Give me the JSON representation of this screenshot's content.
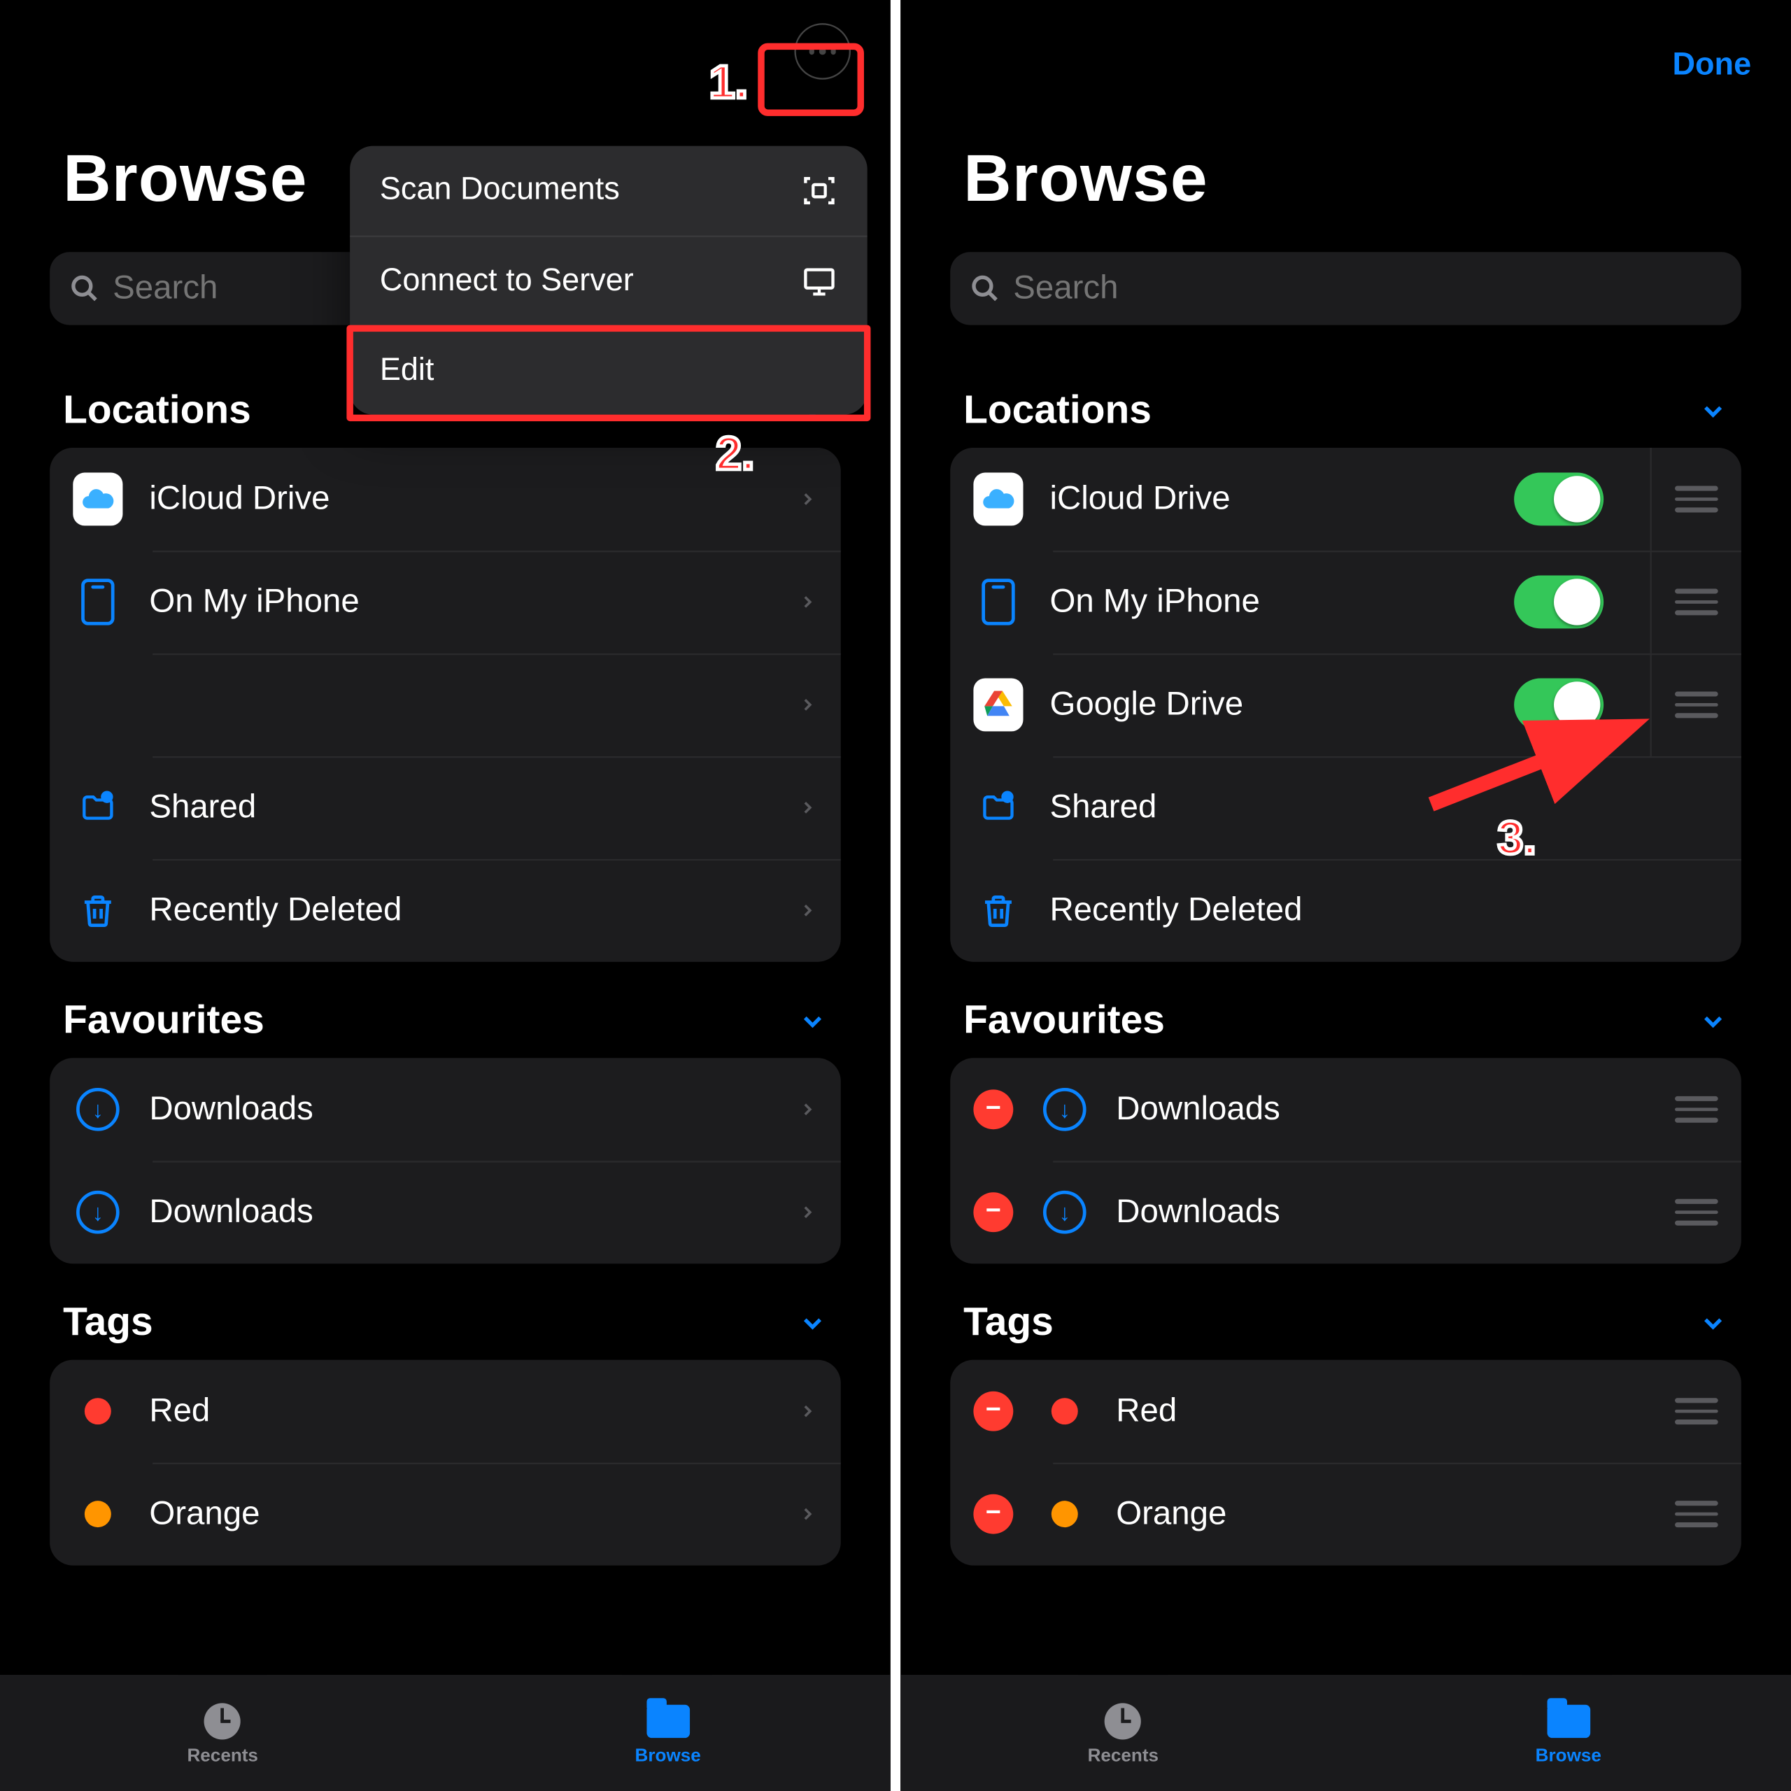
{
  "left": {
    "title": "Browse",
    "search_placeholder": "Search",
    "annotations": {
      "one": "1.",
      "two": "2."
    },
    "menu": {
      "scan": "Scan Documents",
      "connect": "Connect to Server",
      "edit": "Edit"
    },
    "locations_header": "Locations",
    "locations": {
      "icloud": "iCloud Drive",
      "onmyiphone": "On My iPhone",
      "blank": "",
      "shared": "Shared",
      "deleted": "Recently Deleted"
    },
    "favourites_header": "Favourites",
    "favourites": {
      "d1": "Downloads",
      "d2": "Downloads"
    },
    "tags_header": "Tags",
    "tags": {
      "red": "Red",
      "orange": "Orange"
    },
    "tab_recents": "Recents",
    "tab_browse": "Browse"
  },
  "right": {
    "title": "Browse",
    "done": "Done",
    "search_placeholder": "Search",
    "annotations": {
      "three": "3."
    },
    "locations_header": "Locations",
    "locations": {
      "icloud": "iCloud Drive",
      "onmyiphone": "On My iPhone",
      "gdrive": "Google Drive",
      "shared": "Shared",
      "deleted": "Recently Deleted"
    },
    "favourites_header": "Favourites",
    "favourites": {
      "d1": "Downloads",
      "d2": "Downloads"
    },
    "tags_header": "Tags",
    "tags": {
      "red": "Red",
      "orange": "Orange"
    },
    "tab_recents": "Recents",
    "tab_browse": "Browse"
  },
  "colors": {
    "accent": "#0a84ff",
    "toggle_on": "#34c759",
    "highlight": "#ff2d2d",
    "tag_red": "#ff3b30",
    "tag_orange": "#ff9500"
  }
}
